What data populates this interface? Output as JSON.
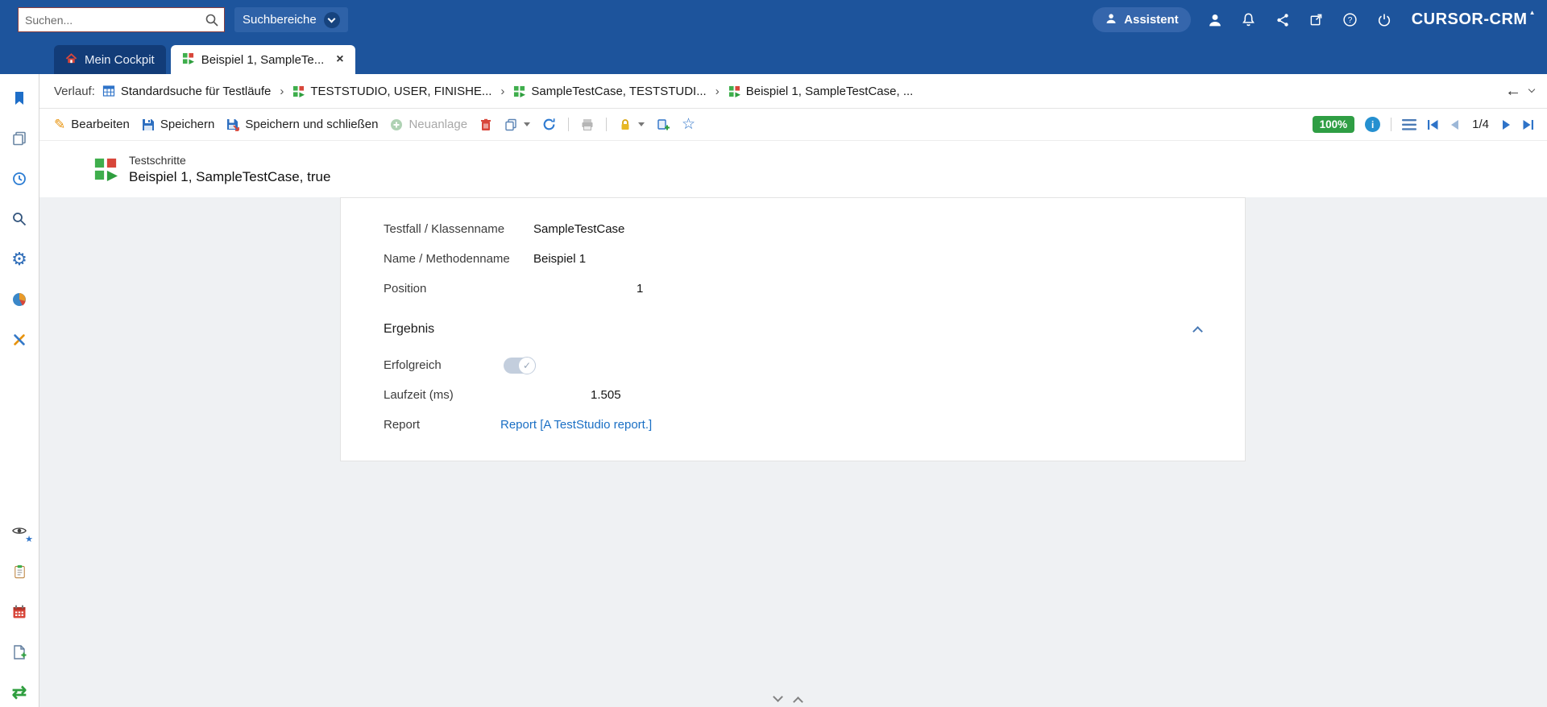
{
  "colors": {
    "topbar_blue": "#1d549c",
    "accent_blue": "#1a6fc4",
    "success_green": "#2f9e44",
    "alert_red": "#d8463a"
  },
  "topbar": {
    "search_placeholder": "Suchen...",
    "search_areas": "Suchbereiche",
    "assistant": "Assistent",
    "brand": "CURSOR-CRM"
  },
  "tabs": {
    "cockpit": "Mein Cockpit",
    "record": "Beispiel 1, SampleTe..."
  },
  "breadcrumb": {
    "label": "Verlauf:",
    "items": [
      "Standardsuche für Testläufe",
      "TESTSTUDIO, USER, FINISHE...",
      "SampleTestCase, TESTSTUDI...",
      "Beispiel 1, SampleTestCase, ..."
    ]
  },
  "toolbar": {
    "edit": "Bearbeiten",
    "save": "Speichern",
    "save_and_close": "Speichern und schließen",
    "new": "Neuanlage",
    "zoom": "100%",
    "page": "1/4"
  },
  "record": {
    "type": "Testschritte",
    "title": "Beispiel 1, SampleTestCase, true"
  },
  "form": {
    "testfall_label": "Testfall / Klassenname",
    "testfall_value": "SampleTestCase",
    "name_label": "Name / Methodenname",
    "name_value": "Beispiel 1",
    "position_label": "Position",
    "position_value": "1",
    "section_title": "Ergebnis",
    "erfolgreich_label": "Erfolgreich",
    "laufzeit_label": "Laufzeit (ms)",
    "laufzeit_value": "1.505",
    "report_label": "Report",
    "report_link": "Report [A TestStudio report.]"
  }
}
